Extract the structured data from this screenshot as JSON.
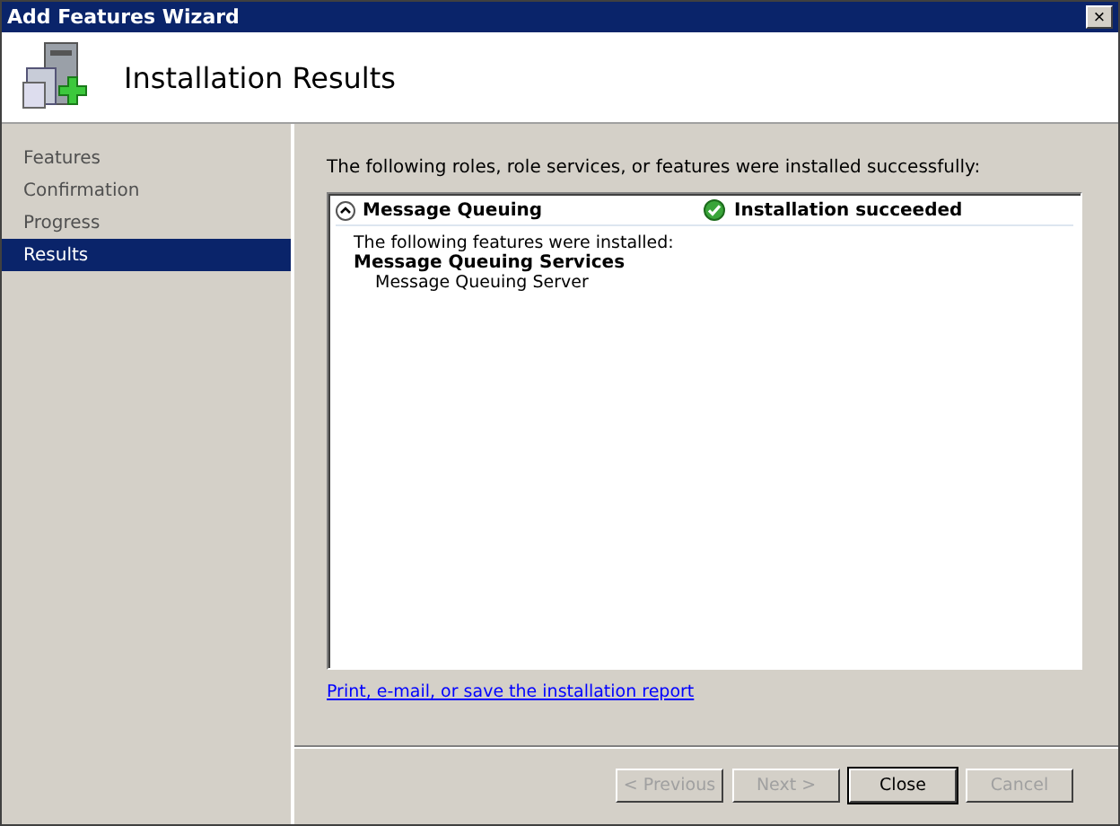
{
  "window": {
    "title": "Add Features Wizard",
    "close_glyph": "×"
  },
  "header": {
    "title": "Installation Results"
  },
  "sidebar": {
    "items": [
      {
        "label": "Features",
        "selected": false
      },
      {
        "label": "Confirmation",
        "selected": false
      },
      {
        "label": "Progress",
        "selected": false
      },
      {
        "label": "Results",
        "selected": true
      }
    ]
  },
  "intro": "The following roles, role services, or features were installed successfully:",
  "results": [
    {
      "name": "Message Queuing",
      "expanded": true,
      "status": "Installation succeeded",
      "detail": "The following features were installed:",
      "groups": [
        {
          "name": "Message Queuing Services",
          "children": [
            {
              "name": "Message Queuing Server"
            }
          ]
        }
      ]
    }
  ],
  "report_link": "Print, e-mail, or save the installation report",
  "buttons": [
    {
      "label": "< Previous",
      "disabled": true,
      "default": false
    },
    {
      "label": "Next >",
      "disabled": true,
      "default": false
    },
    {
      "label": "Close",
      "disabled": false,
      "default": true
    },
    {
      "label": "Cancel",
      "disabled": true,
      "default": false
    }
  ]
}
